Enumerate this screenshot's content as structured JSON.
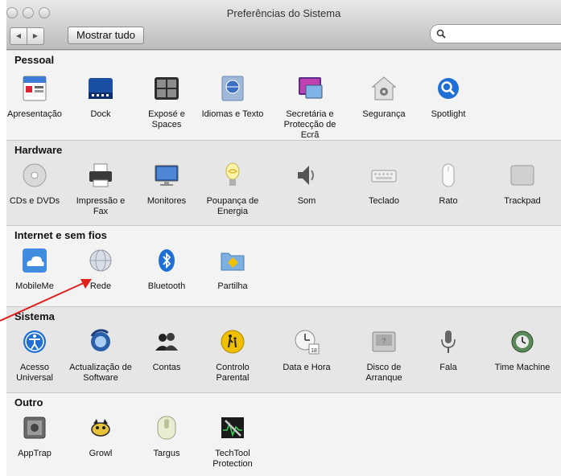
{
  "window": {
    "title": "Preferências do Sistema"
  },
  "toolbar": {
    "show_all": "Mostrar tudo",
    "back": "◀",
    "forward": "▶",
    "search_glyph": "🔍"
  },
  "sections": [
    {
      "title": "Pessoal",
      "items": [
        {
          "label": "Apresentação",
          "icon": "appearance-icon"
        },
        {
          "label": "Dock",
          "icon": "dock-icon"
        },
        {
          "label": "Exposé e Spaces",
          "icon": "expose-spaces-icon"
        },
        {
          "label": "Idiomas e Texto",
          "icon": "language-text-icon"
        },
        {
          "label": "Secretária e Protecção de Ecrã",
          "icon": "desktop-screensaver-icon"
        },
        {
          "label": "Segurança",
          "icon": "security-icon"
        },
        {
          "label": "Spotlight",
          "icon": "spotlight-icon"
        }
      ]
    },
    {
      "title": "Hardware",
      "items": [
        {
          "label": "CDs e DVDs",
          "icon": "cd-dvd-icon"
        },
        {
          "label": "Impressão e Fax",
          "icon": "printer-fax-icon"
        },
        {
          "label": "Monitores",
          "icon": "displays-icon"
        },
        {
          "label": "Poupança de Energia",
          "icon": "energy-saver-icon"
        },
        {
          "label": "Som",
          "icon": "sound-icon"
        },
        {
          "label": "Teclado",
          "icon": "keyboard-icon"
        },
        {
          "label": "Rato",
          "icon": "mouse-icon"
        },
        {
          "label": "Trackpad",
          "icon": "trackpad-icon"
        }
      ]
    },
    {
      "title": "Internet e sem fios",
      "items": [
        {
          "label": "MobileMe",
          "icon": "mobileme-icon"
        },
        {
          "label": "Rede",
          "icon": "network-icon"
        },
        {
          "label": "Bluetooth",
          "icon": "bluetooth-icon"
        },
        {
          "label": "Partilha",
          "icon": "sharing-icon"
        }
      ]
    },
    {
      "title": "Sistema",
      "items": [
        {
          "label": "Acesso Universal",
          "icon": "universal-access-icon"
        },
        {
          "label": "Actualização de Software",
          "icon": "software-update-icon"
        },
        {
          "label": "Contas",
          "icon": "accounts-icon"
        },
        {
          "label": "Controlo Parental",
          "icon": "parental-controls-icon"
        },
        {
          "label": "Data e Hora",
          "icon": "date-time-icon"
        },
        {
          "label": "Disco de Arranque",
          "icon": "startup-disk-icon"
        },
        {
          "label": "Fala",
          "icon": "speech-icon"
        },
        {
          "label": "Time Machine",
          "icon": "time-machine-icon"
        }
      ]
    },
    {
      "title": "Outro",
      "items": [
        {
          "label": "AppTrap",
          "icon": "apptrap-icon"
        },
        {
          "label": "Growl",
          "icon": "growl-icon"
        },
        {
          "label": "Targus",
          "icon": "targus-icon"
        },
        {
          "label": "TechTool Protection",
          "icon": "techtool-icon"
        }
      ]
    }
  ],
  "colors": {
    "accent_blue": "#1f6fd6",
    "annotation_red": "#e0201b"
  }
}
